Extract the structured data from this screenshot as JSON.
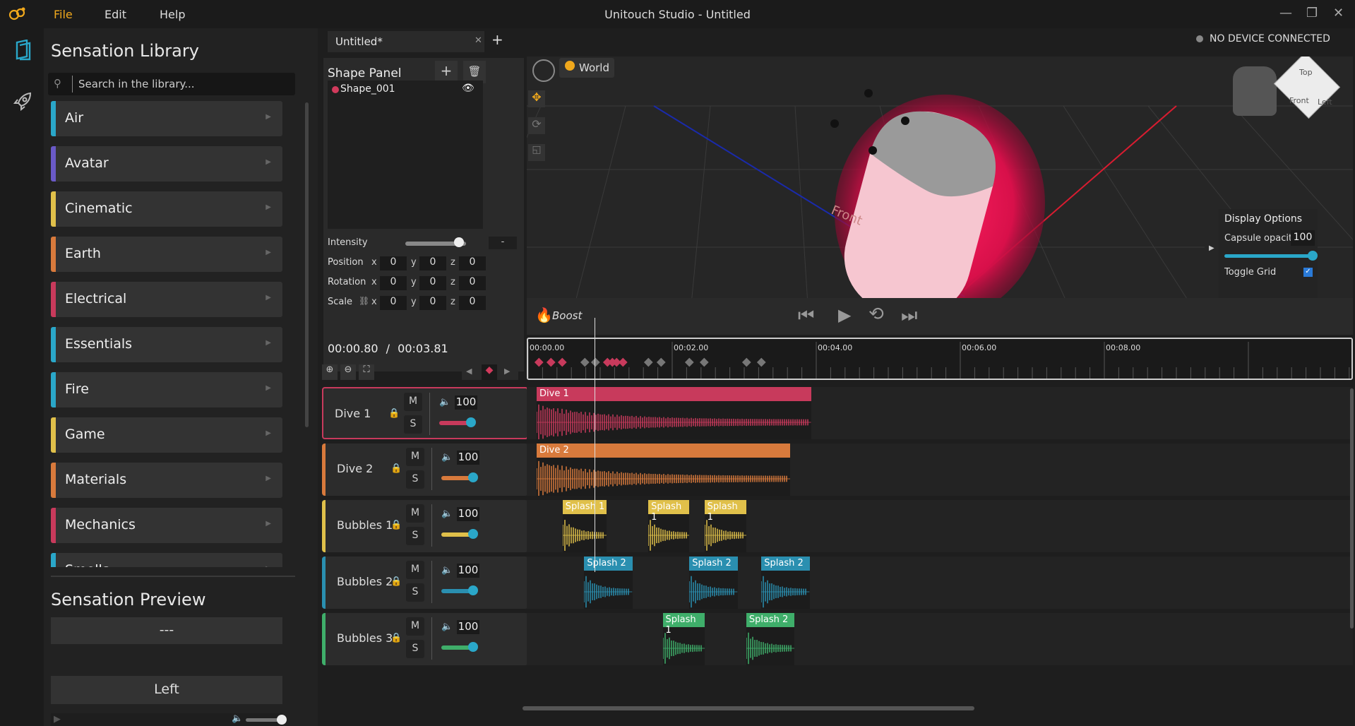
{
  "app": {
    "title": "Unitouch Studio - Untitled",
    "menu": [
      "File",
      "Edit",
      "Help"
    ],
    "accent": "#f0a81c"
  },
  "library": {
    "title": "Sensation Library",
    "search_placeholder": "Search in the library...",
    "categories": [
      {
        "label": "Air",
        "color": "#2aa7c9"
      },
      {
        "label": "Avatar",
        "color": "#6a5ac7"
      },
      {
        "label": "Cinematic",
        "color": "#e0c04a"
      },
      {
        "label": "Earth",
        "color": "#d87a3c"
      },
      {
        "label": "Electrical",
        "color": "#c83a5c"
      },
      {
        "label": "Essentials",
        "color": "#2aa7c9"
      },
      {
        "label": "Fire",
        "color": "#2aa7c9"
      },
      {
        "label": "Game",
        "color": "#e0c04a"
      },
      {
        "label": "Materials",
        "color": "#d87a3c"
      },
      {
        "label": "Mechanics",
        "color": "#c83a5c"
      },
      {
        "label": "Smells",
        "color": "#2aa7c9"
      }
    ]
  },
  "preview": {
    "title": "Sensation Preview",
    "sensation": "---",
    "direction": "Left"
  },
  "editor": {
    "tab_label": "Untitled*",
    "device_status": "NO DEVICE CONNECTED"
  },
  "shape_panel": {
    "title": "Shape Panel",
    "shapes": [
      {
        "name": "Shape_001",
        "color": "#d13a5c"
      }
    ],
    "intensity_label": "Intensity",
    "intensity_value": "-",
    "intensity_level": 0.88,
    "position_label": "Position",
    "rotation_label": "Rotation",
    "scale_label": "Scale",
    "position": {
      "x": "0",
      "y": "0",
      "z": "0"
    },
    "rotation": {
      "x": "0",
      "y": "0",
      "z": "0"
    },
    "scale": {
      "x": "0",
      "y": "0",
      "z": "0"
    }
  },
  "viewport": {
    "space_label": "World",
    "capsule_label": "Front",
    "cube_labels": {
      "top": "Top",
      "front": "Front",
      "left": "Left"
    },
    "display_options": {
      "title": "Display Options",
      "capsule_opacity_label": "Capsule opacity",
      "capsule_opacity_value": "100",
      "toggle_grid_label": "Toggle Grid",
      "toggle_grid_checked": true
    },
    "boost_label": "Boost"
  },
  "timeline": {
    "current_time": "00:00.80",
    "separator": "/",
    "total_time": "00:03.81",
    "ruler_labels": [
      "00:00.00",
      "00:02.00",
      "00:04.00",
      "00:06.00",
      "00:08.00"
    ],
    "tracks": [
      {
        "name": "Dive 1",
        "color": "#c83a5c",
        "volume": "100",
        "mute": "M",
        "solo": "S",
        "clips": [
          {
            "label": "Dive 1",
            "start": 0.0,
            "end": 3.81
          }
        ]
      },
      {
        "name": "Dive 2",
        "color": "#d87a3c",
        "volume": "100",
        "mute": "M",
        "solo": "S",
        "clips": [
          {
            "label": "Dive 2",
            "start": 0.0,
            "end": 3.52
          }
        ]
      },
      {
        "name": "Bubbles 1",
        "color": "#e0c04a",
        "volume": "100",
        "mute": "M",
        "solo": "S",
        "clips": [
          {
            "label": "Splash 1",
            "start": 0.36,
            "end": 0.97
          },
          {
            "label": "Splash 1",
            "start": 1.55,
            "end": 2.12
          },
          {
            "label": "Splash 1",
            "start": 2.33,
            "end": 2.91
          }
        ]
      },
      {
        "name": "Bubbles 2",
        "color": "#2a8fb0",
        "volume": "100",
        "mute": "M",
        "solo": "S",
        "clips": [
          {
            "label": "Splash 2",
            "start": 0.66,
            "end": 1.33
          },
          {
            "label": "Splash 2",
            "start": 2.12,
            "end": 2.79
          },
          {
            "label": "Splash 2",
            "start": 3.12,
            "end": 3.79
          }
        ]
      },
      {
        "name": "Bubbles 3",
        "color": "#3fae6a",
        "volume": "100",
        "mute": "M",
        "solo": "S",
        "clips": [
          {
            "label": "Splash 1",
            "start": 1.75,
            "end": 2.33
          },
          {
            "label": "Splash 2",
            "start": 2.91,
            "end": 3.58
          }
        ]
      }
    ]
  }
}
